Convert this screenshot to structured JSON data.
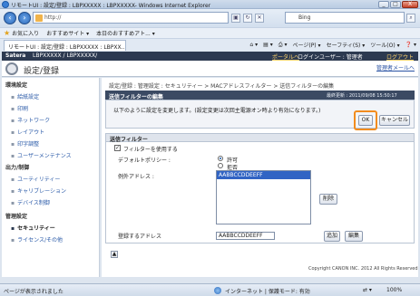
{
  "window": {
    "title": "リモートUI : 設定/登録 : LBPXXXXX : LBPXXXXX- Windows Internet Explorer",
    "min": "_",
    "max": "□",
    "close": "X"
  },
  "addressbar": {
    "url": "http://",
    "search_placeholder": "Bing"
  },
  "favorites": {
    "label": "お気に入り",
    "item1": "おすすめサイト ▾",
    "item2": "本日のおすすめアト... ▾"
  },
  "tab": {
    "label": "リモートUI : 設定/登録 : LBPXXXXX : LBPXX..."
  },
  "toolbar": {
    "page": "ページ(P) ▾",
    "safety": "セーフティ(S) ▾",
    "tools": "ツール(O) ▾",
    "help": "❓ ▾"
  },
  "header": {
    "brand": "Satera",
    "model": "LBPXXXXX / LBPXXXXX/",
    "portal": "ポータルへ",
    "login_user": "ログインユーザー : 管理者",
    "logout": "ログアウト",
    "page_title": "設定/登録",
    "to_admin": "管理者メールへ"
  },
  "sidebar": {
    "env_head": "環境設定",
    "env_items": [
      "給紙設定",
      "印刷",
      "ネットワーク",
      "レイアウト",
      "印字調整",
      "ユーザーメンテナンス"
    ],
    "output_head": "出力/制御",
    "output_items": [
      "ユーティリティー",
      "キャリブレーション",
      "デバイス制御"
    ],
    "mgmt_head": "管理設定",
    "mgmt_items": [
      "セキュリティー",
      "ライセンス/その他"
    ]
  },
  "main": {
    "breadcrumb": "設定/登録 : 管理設定 : セキュリティー > MACアドレスフィルター > 送信フィルターの編集",
    "panel_title": "送信フィルターの編集",
    "last_updated": "最終更新 : 2011/09/08 15:50:17",
    "message": "以下のように設定を変更します。(設定変更は次回主電源オン時より有効になります。)",
    "ok": "OK",
    "cancel": "キャンセル",
    "filter_head": "送信フィルター",
    "use_filter": "フィルターを使用する",
    "default_policy_label": "デフォルトポリシー :",
    "allow": "許可",
    "deny": "拒否",
    "exception_label": "例外アドレス :",
    "exception_items": [
      "AABBCCDDEEFF"
    ],
    "delete": "削除",
    "register_label": "登録するアドレス",
    "register_value": "AABBCCDDEEFF",
    "add": "追加",
    "edit": "編集",
    "pagetop": "▲",
    "copyright": "Copyright CANON INC. 2012 All Rights Reserved"
  },
  "status": {
    "left": "ページが表示されました",
    "zone": "インターネット | 保護モード: 有効",
    "zoom": "100%"
  }
}
